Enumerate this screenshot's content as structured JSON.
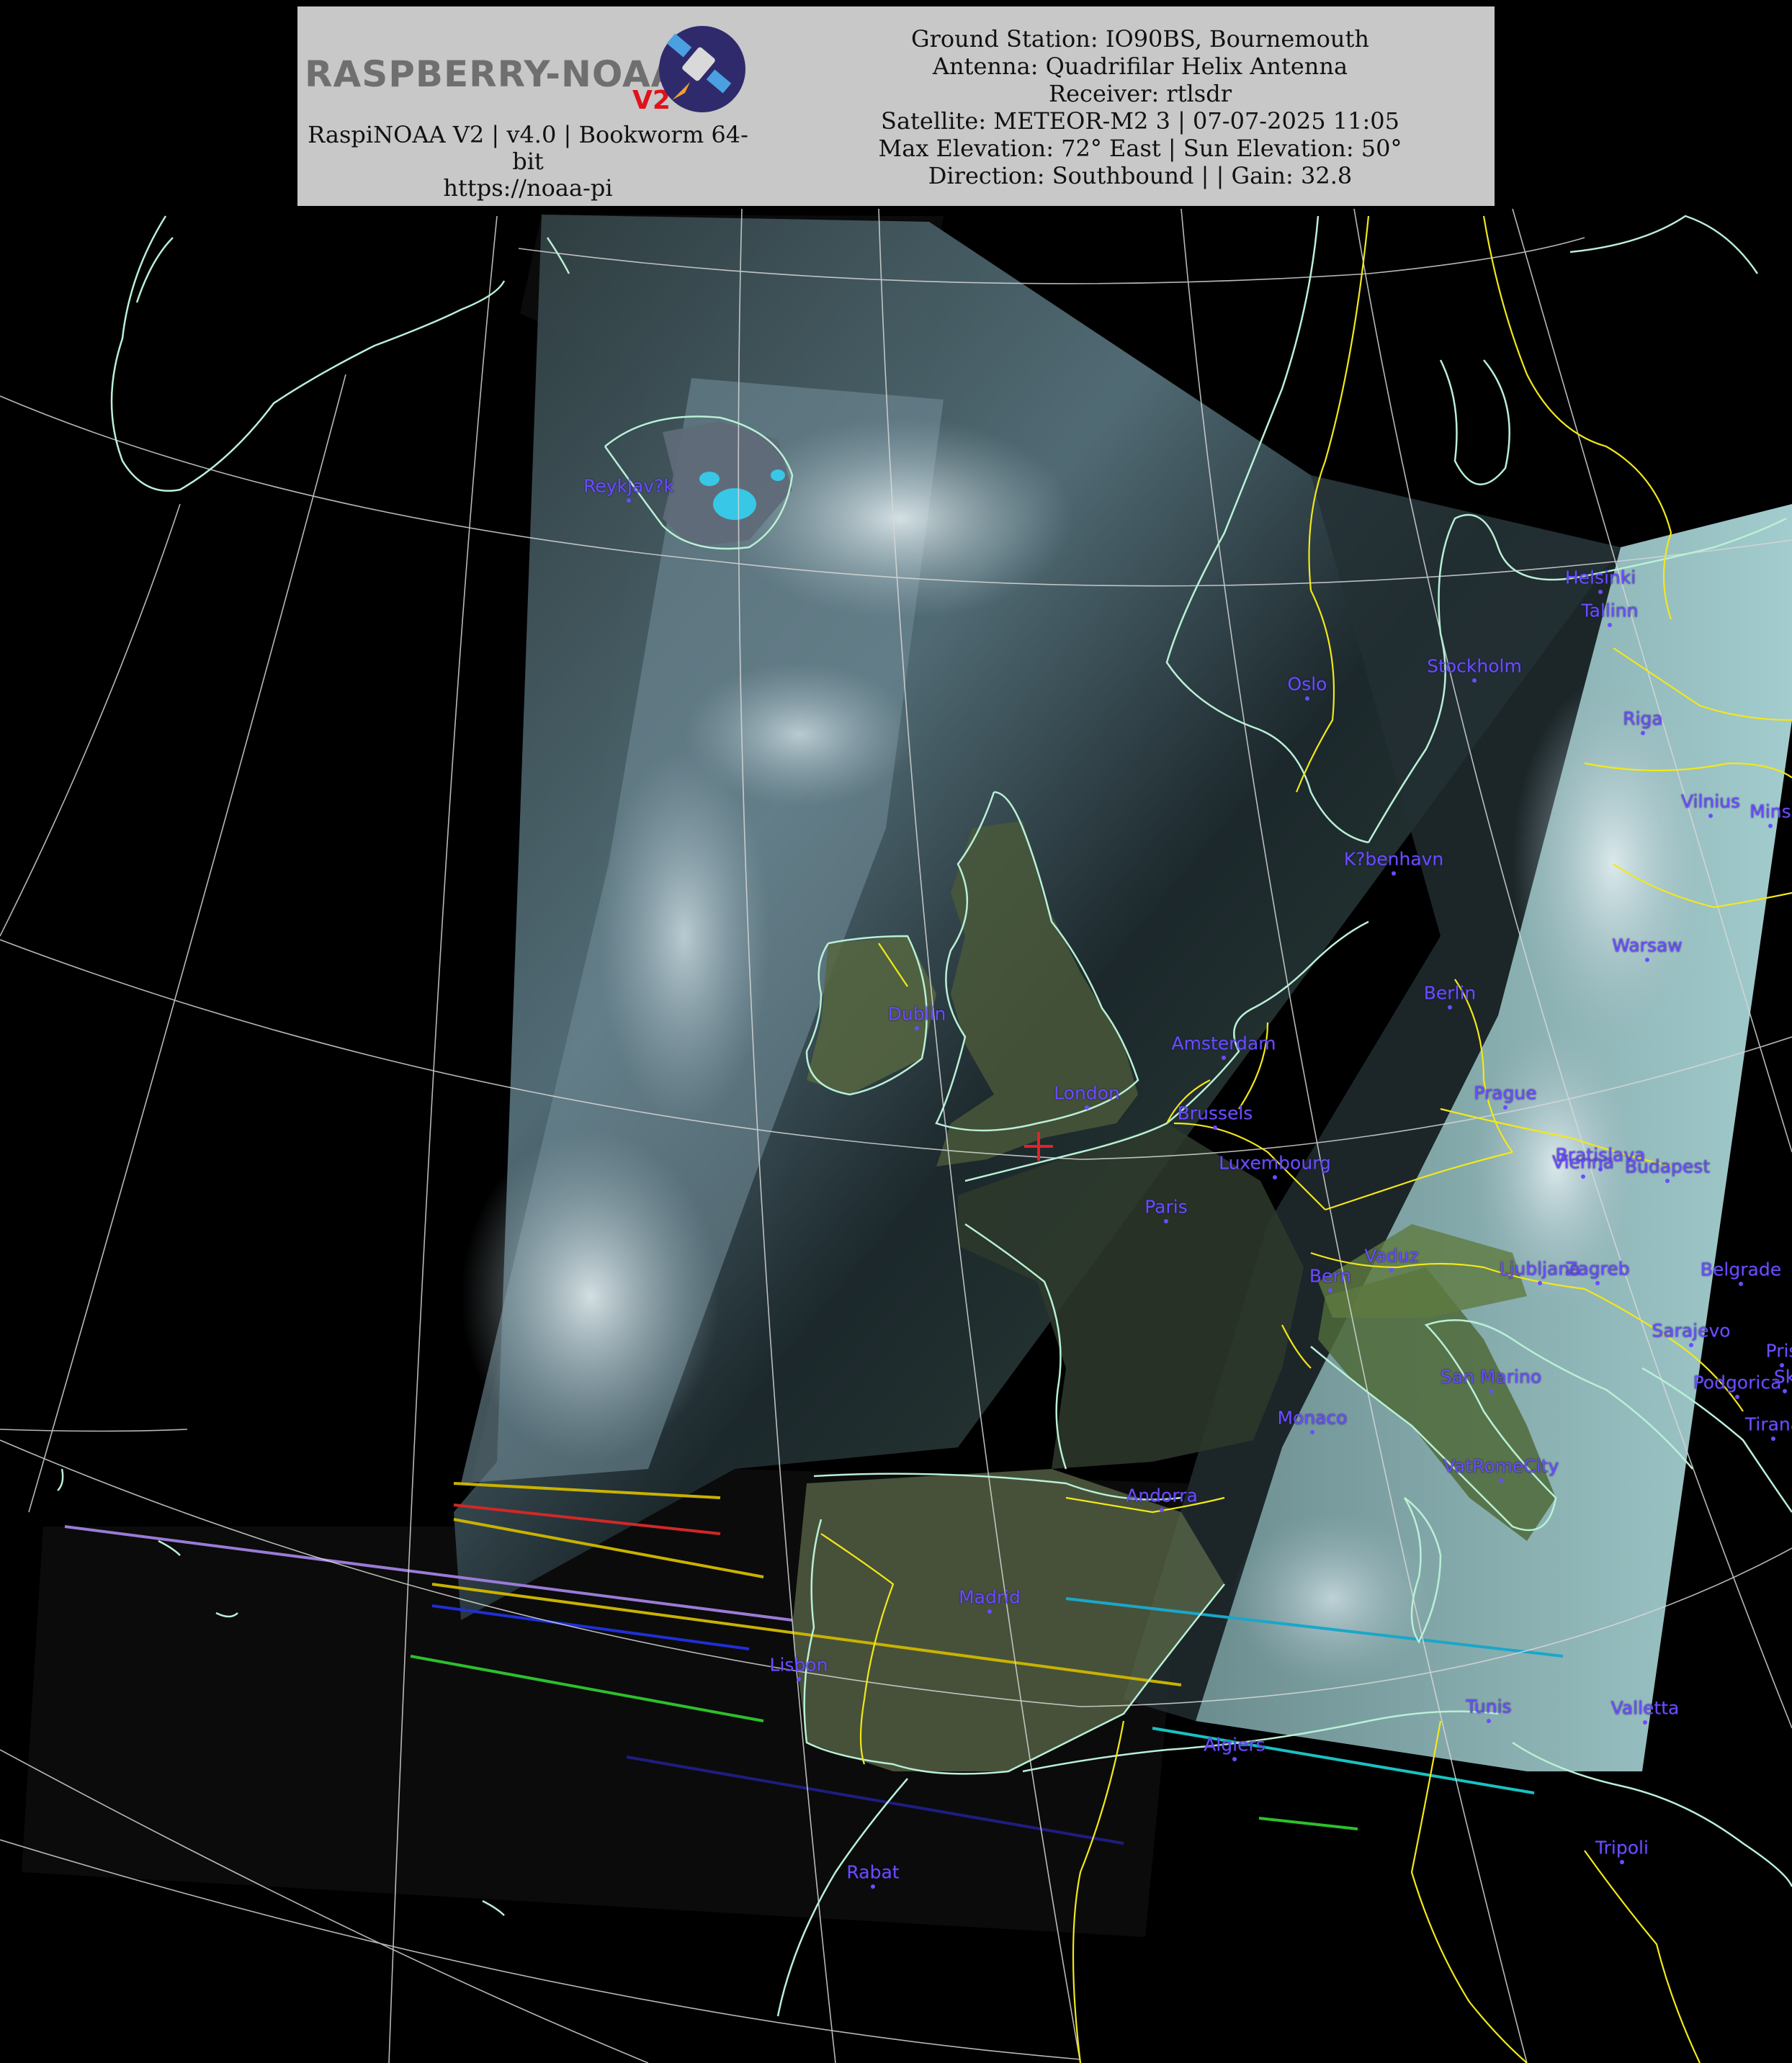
{
  "header": {
    "logo_text": "RASPBERRY-NOAA",
    "logo_version": "V2",
    "left_lines": [
      "RaspiNOAA V2 | v4.0 | Bookworm 64-",
      "bit",
      "https://noaa-pi"
    ],
    "right_lines": [
      "Ground Station: IO90BS, Bournemouth",
      "Antenna: Quadrifilar Helix Antenna",
      "Receiver: rtlsdr",
      "Satellite: METEOR-M2 3 | 07-07-2025 11:05",
      "Max Elevation: 72° East | Sun Elevation: 50°",
      "Direction: Southbound | | Gain: 32.8"
    ]
  },
  "colors": {
    "coastline": "#b9f0d6",
    "border": "#f2e81a",
    "graticule": "#d8d8d8",
    "city_label": "#6a4dff",
    "station_marker": "#e2232a",
    "header_bg": "#c8c8c8"
  },
  "cities": [
    {
      "name": "Reykjav?k"
    },
    {
      "name": "Helsinki"
    },
    {
      "name": "Tallinn"
    },
    {
      "name": "Oslo"
    },
    {
      "name": "Stockholm"
    },
    {
      "name": "Riga"
    },
    {
      "name": "Vilnius"
    },
    {
      "name": "Mins"
    },
    {
      "name": "K?benhavn"
    },
    {
      "name": "Warsaw"
    },
    {
      "name": "Berlin"
    },
    {
      "name": "Dublin"
    },
    {
      "name": "Amsterdam"
    },
    {
      "name": "London"
    },
    {
      "name": "Brussels"
    },
    {
      "name": "Prague"
    },
    {
      "name": "Luxembourg"
    },
    {
      "name": "Bratislava"
    },
    {
      "name": "Vienna"
    },
    {
      "name": "Budapest"
    },
    {
      "name": "Paris"
    },
    {
      "name": "Vaduz"
    },
    {
      "name": "Bern"
    },
    {
      "name": "Ljubljana"
    },
    {
      "name": "Zagreb"
    },
    {
      "name": "Belgrade"
    },
    {
      "name": "Sarajevo"
    },
    {
      "name": "Pris"
    },
    {
      "name": "San Marino"
    },
    {
      "name": "Podgorica"
    },
    {
      "name": "Sk"
    },
    {
      "name": "Monaco"
    },
    {
      "name": "Tirana"
    },
    {
      "name": "VatRomeCity"
    },
    {
      "name": "Andorra"
    },
    {
      "name": "Madrid"
    },
    {
      "name": "Lisbon"
    },
    {
      "name": "Tunis"
    },
    {
      "name": "Valletta"
    },
    {
      "name": "Algiers"
    },
    {
      "name": "Tripoli"
    },
    {
      "name": "Rabat"
    }
  ],
  "icons": {
    "station_marker": "plus-icon",
    "logo_badge": "satellite-icon"
  }
}
